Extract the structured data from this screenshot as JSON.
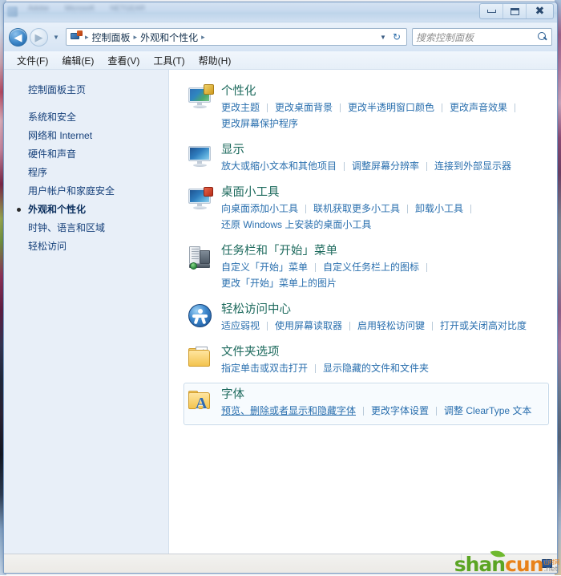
{
  "window": {
    "title_obscured": [
      "Adobe",
      "Microsoft",
      "NETGEAR"
    ],
    "controls": {
      "minimize": "最小化",
      "maximize": "最大化",
      "close": "关闭"
    }
  },
  "nav": {
    "back": "后退",
    "forward": "前进",
    "recent_pages": "最近浏览的位置",
    "refresh": "刷新",
    "breadcrumb": [
      "控制面板",
      "外观和个性化"
    ],
    "breadcrumb_sep": "▸"
  },
  "search": {
    "placeholder": "搜索控制面板",
    "value": ""
  },
  "menubar": {
    "items": [
      "文件(F)",
      "编辑(E)",
      "查看(V)",
      "工具(T)",
      "帮助(H)"
    ]
  },
  "sidebar": {
    "home": "控制面板主页",
    "items": [
      {
        "label": "系统和安全",
        "current": false
      },
      {
        "label": "网络和 Internet",
        "current": false
      },
      {
        "label": "硬件和声音",
        "current": false
      },
      {
        "label": "程序",
        "current": false
      },
      {
        "label": "用户帐户和家庭安全",
        "current": false
      },
      {
        "label": "外观和个性化",
        "current": true
      },
      {
        "label": "时钟、语言和区域",
        "current": false
      },
      {
        "label": "轻松访问",
        "current": false
      }
    ]
  },
  "categories": [
    {
      "id": "personalization",
      "icon": "monitor-personalize-icon",
      "title": "个性化",
      "selected": false,
      "links": [
        {
          "label": "更改主题",
          "hovered": false
        },
        {
          "label": "更改桌面背景",
          "hovered": false
        },
        {
          "label": "更改半透明窗口颜色",
          "hovered": false
        },
        {
          "label": "更改声音效果",
          "hovered": false
        },
        {
          "label": "更改屏幕保护程序",
          "hovered": false,
          "newline": true
        }
      ]
    },
    {
      "id": "display",
      "icon": "monitor-display-icon",
      "title": "显示",
      "selected": false,
      "links": [
        {
          "label": "放大或缩小文本和其他项目",
          "hovered": false
        },
        {
          "label": "调整屏幕分辨率",
          "hovered": false
        },
        {
          "label": "连接到外部显示器",
          "hovered": false
        }
      ]
    },
    {
      "id": "gadgets",
      "icon": "desktop-gadgets-icon",
      "title": "桌面小工具",
      "selected": false,
      "links": [
        {
          "label": "向桌面添加小工具",
          "hovered": false
        },
        {
          "label": "联机获取更多小工具",
          "hovered": false
        },
        {
          "label": "卸载小工具",
          "hovered": false
        },
        {
          "label": "还原 Windows 上安装的桌面小工具",
          "hovered": false,
          "newline": true
        }
      ]
    },
    {
      "id": "taskbar",
      "icon": "taskbar-startmenu-icon",
      "title": "任务栏和「开始」菜单",
      "selected": false,
      "links": [
        {
          "label": "自定义「开始」菜单",
          "hovered": false
        },
        {
          "label": "自定义任务栏上的图标",
          "hovered": false
        },
        {
          "label": "更改「开始」菜单上的图片",
          "hovered": false,
          "newline": true
        }
      ]
    },
    {
      "id": "ease-of-access",
      "icon": "ease-of-access-icon",
      "title": "轻松访问中心",
      "selected": false,
      "links": [
        {
          "label": "适应弱视",
          "hovered": false
        },
        {
          "label": "使用屏幕读取器",
          "hovered": false
        },
        {
          "label": "启用轻松访问键",
          "hovered": false
        },
        {
          "label": "打开或关闭高对比度",
          "hovered": false
        }
      ]
    },
    {
      "id": "folder-options",
      "icon": "folder-options-icon",
      "title": "文件夹选项",
      "selected": false,
      "links": [
        {
          "label": "指定单击或双击打开",
          "hovered": false
        },
        {
          "label": "显示隐藏的文件和文件夹",
          "hovered": false
        }
      ]
    },
    {
      "id": "fonts",
      "icon": "fonts-folder-icon",
      "title": "字体",
      "selected": true,
      "links": [
        {
          "label": "预览、删除或者显示和隐藏字体",
          "hovered": true
        },
        {
          "label": "更改字体设置",
          "hovered": false
        },
        {
          "label": "调整 ClearType 文本",
          "hovered": false
        }
      ]
    }
  ],
  "statusbar": {
    "text": "",
    "icon": "computer-icon"
  },
  "watermark": {
    "part1": "shan",
    "part2": "cun",
    "chinese": "山村网",
    "domain": ".net",
    "color1": "#5ba524",
    "color2": "#e8821a"
  }
}
